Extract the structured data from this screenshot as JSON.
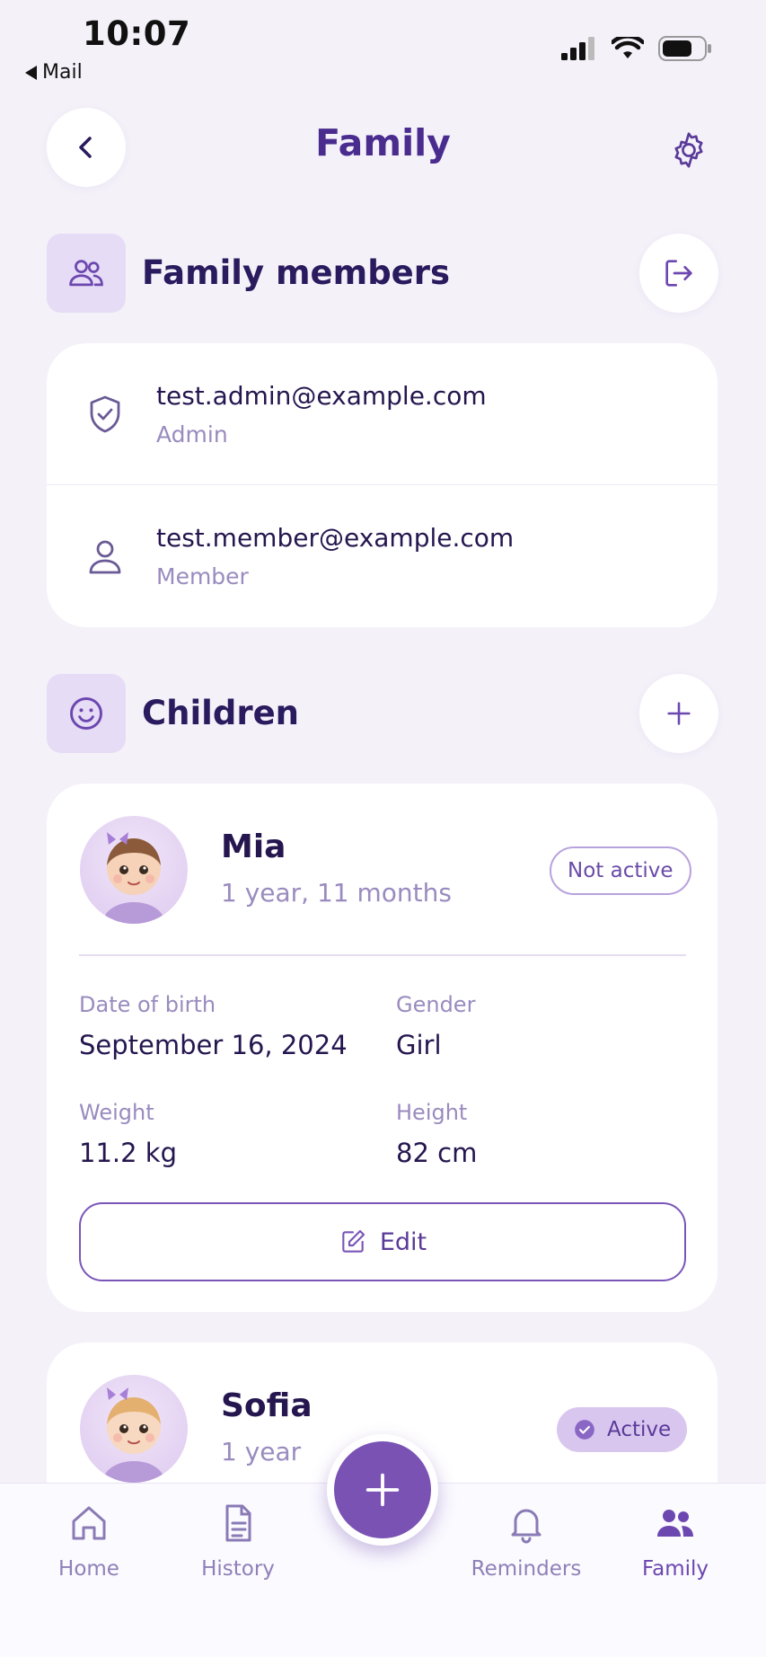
{
  "status_bar": {
    "time": "10:07",
    "back_app": "Mail"
  },
  "header": {
    "title": "Family",
    "back_icon": "chevron-left-icon",
    "settings_icon": "gear-icon"
  },
  "family_members": {
    "title": "Family members",
    "icon": "users-icon",
    "leave_icon": "logout-icon",
    "members": [
      {
        "email": "test.admin@example.com",
        "role": "Admin",
        "icon": "shield-check-icon"
      },
      {
        "email": "test.member@example.com",
        "role": "Member",
        "icon": "user-icon"
      }
    ]
  },
  "children": {
    "title": "Children",
    "icon": "smile-icon",
    "add_icon": "plus-icon",
    "list": [
      {
        "name": "Mia",
        "age": "1 year, 11 months",
        "status": "Not active",
        "details": {
          "dob_label": "Date of birth",
          "dob": "September 16, 2024",
          "gender_label": "Gender",
          "gender": "Girl",
          "weight_label": "Weight",
          "weight": "11.2 kg",
          "height_label": "Height",
          "height": "82 cm"
        },
        "edit_label": "Edit"
      },
      {
        "name": "Sofia",
        "age": "1 year",
        "status": "Active"
      }
    ]
  },
  "bottom_nav": {
    "items": [
      {
        "label": "Home",
        "icon": "home-icon"
      },
      {
        "label": "History",
        "icon": "document-icon"
      },
      {
        "label": "Reminders",
        "icon": "bell-icon"
      },
      {
        "label": "Family",
        "icon": "family-icon"
      }
    ],
    "active": "Family",
    "fab_icon": "plus-icon"
  },
  "colors": {
    "accent": "#6c47b0",
    "background": "#f4f1f9",
    "card": "#ffffff"
  }
}
